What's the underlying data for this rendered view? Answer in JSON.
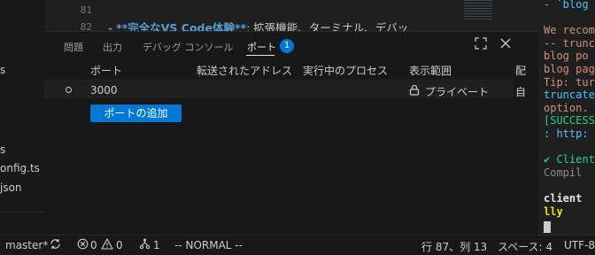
{
  "explorer": {
    "items": [
      "s",
      "s",
      "onfig.ts",
      "json"
    ]
  },
  "editor": {
    "lines": [
      {
        "number": "81",
        "text": ""
      },
      {
        "number": "82",
        "marker": "-",
        "bold": "**完全なVS Code体験**",
        "rest": ": 拡張機能、ターミナル、デバッ"
      }
    ]
  },
  "panel": {
    "tabs": [
      "問題",
      "出力",
      "デバッグ コンソール",
      "ポート"
    ],
    "active_tab": "ポート",
    "ports_badge": "1",
    "columns": [
      "ポート",
      "転送されたアドレス",
      "実行中のプロセス",
      "表示範囲",
      "配"
    ],
    "rows": [
      {
        "port": "3000",
        "forwarded": "",
        "process": "",
        "visibility": "プライベート",
        "origin": "自"
      }
    ],
    "add_port_label": "ポートの追加"
  },
  "terminal": {
    "lines": [
      {
        "text": "- `blog",
        "color": "#4fc1ff"
      },
      {
        "text": "",
        "color": "#cccccc"
      },
      {
        "text": "We recom",
        "color": "#ce9178"
      },
      {
        "text": "-- trunc",
        "color": "#ce9178"
      },
      {
        "text": " blog po",
        "color": "#ce9178"
      },
      {
        "text": "blog pag",
        "color": "#ce9178"
      },
      {
        "text": "Tip: tur",
        "color": "#ce9178"
      },
      {
        "text": "truncate",
        "color": "#4fc1ff"
      },
      {
        "text": "option.",
        "color": "#ce9178"
      },
      {
        "text": "[SUCCESS",
        "color": "#23d18b"
      },
      {
        "text": ": http:",
        "color": "#4fc1ff"
      },
      {
        "text": "",
        "color": "#cccccc"
      },
      {
        "text": "✔ Client",
        "color": "#23d18b"
      },
      {
        "text": "  Compil",
        "color": "#8b8b8b"
      },
      {
        "text": "",
        "color": "#cccccc"
      },
      {
        "text": "client",
        "color": "#e7e7e7"
      },
      {
        "text": "lly",
        "color": "#e2e210"
      }
    ]
  },
  "statusbar": {
    "branch": "master*",
    "errors": "0",
    "warnings": "0",
    "ports": "1",
    "mode": "-- NORMAL --",
    "position": "行 87、列 13",
    "spaces": "スペース: 4",
    "encoding": "UTF-8"
  },
  "colors": {
    "accent": "#0078d4",
    "background": "#1e1e1e",
    "panel": "#181818"
  }
}
